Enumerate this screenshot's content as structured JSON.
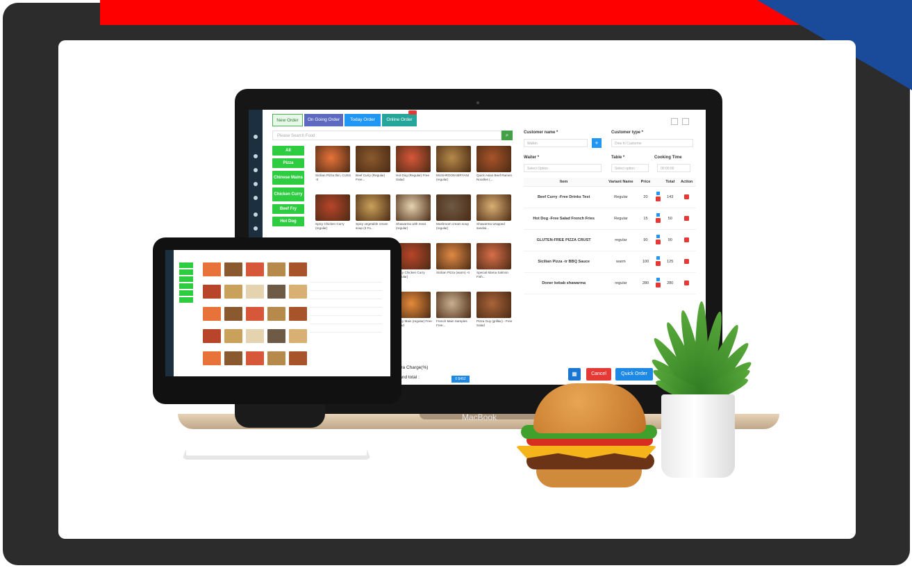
{
  "tabs": {
    "new_order": "New Order",
    "ongoing": "On Going Order",
    "today": "Today Order",
    "online": "Online Order"
  },
  "search_placeholder": "Please Search Food",
  "categories": [
    "All",
    "Pizza",
    "Chinese Mains",
    "Chicken Curry",
    "Beef Fry",
    "Hot Dog"
  ],
  "foods": [
    {
      "name": "Sicilian Pizza thin, CUSS -tr",
      "color": "#e8733a"
    },
    {
      "name": "Beef Curry (Regular) Free...",
      "color": "#8a5a2e"
    },
    {
      "name": "Hot Dog (Regular) Free Salad",
      "color": "#d7573a"
    },
    {
      "name": "MUSHROOM BIRYANI (regular)",
      "color": "#b58a4a"
    },
    {
      "name": "Quick Asian Beef Ramen Noodles (...",
      "color": "#a8542a"
    },
    {
      "name": "Spicy Chicken Curry (regular)",
      "color": "#b8452a"
    },
    {
      "name": "Spicy vegetable cream soup (3 Fo...",
      "color": "#c9a15a"
    },
    {
      "name": "Shawarma with meat (regular)",
      "color": "#e5d3b0"
    },
    {
      "name": "Mushroom cream soup (regular)",
      "color": "#6e5a45"
    },
    {
      "name": "Shawarma wrapped sandwi...",
      "color": "#d9b073"
    }
  ],
  "foods_lower": [
    {
      "name": "Spicy Chicken Curry (regular)",
      "color": "#b8452a"
    },
    {
      "name": "Sicilian Pizza (warm) -tr",
      "color": "#e08a44"
    },
    {
      "name": "Special Mama Salmon Fish...",
      "color": "#d86e4a"
    },
    {
      "name": "Spicy Main (regular) Free Salad",
      "color": "#e58a3a"
    },
    {
      "name": "French Main Samples Free...",
      "color": "#c9b090"
    },
    {
      "name": "Pizza Guy (grill&c) - Free Salad",
      "color": "#a9643a"
    }
  ],
  "customer_name": {
    "label": "Customer name *",
    "value": "Walkin"
  },
  "customer_type": {
    "label": "Customer type *",
    "value": "Dine In Customer"
  },
  "waiter": {
    "label": "Waiter *",
    "value": "Select Option"
  },
  "table": {
    "label": "Table *",
    "value": "Select option"
  },
  "cooking_time": {
    "label": "Cooking Time",
    "value": "00:00:00"
  },
  "order_table": {
    "headers": [
      "Item",
      "Variant Name",
      "Price",
      "",
      "Total",
      "Action"
    ],
    "rows": [
      {
        "item": "Beef Curry -Free Drinks Test",
        "variant": "Regular",
        "price": "20",
        "total": "143"
      },
      {
        "item": "Hot Dog -Free Salad French Fries",
        "variant": "Regular",
        "price": "15",
        "total": "50"
      },
      {
        "item": "GLUTEN-FREE PIZZA CRUST",
        "variant": "regular",
        "price": "90",
        "total": "90"
      },
      {
        "item": "Sicilian Pizza -tr BBQ Sauce",
        "variant": "warm",
        "price": "100",
        "total": "125"
      },
      {
        "item": "Doner kebab shawarma",
        "variant": "regular",
        "price": "280",
        "total": "280"
      }
    ]
  },
  "extra_charge": "Extra Charge(%)",
  "grand_total": "Grand total :",
  "order_btn": "0 $452",
  "cancel": "Cancel",
  "quick_order": "Quick Order",
  "laptop_brand": "MacBook",
  "colors": {
    "banner": "#ff0000",
    "corner": "#1a4a9a",
    "frame": "#2c2c2c",
    "category": "#2ecc40"
  },
  "icons": [
    "calculator-icon",
    "search-icon",
    "grid-icon",
    "expand-icon",
    "plus-icon",
    "delete-icon"
  ]
}
